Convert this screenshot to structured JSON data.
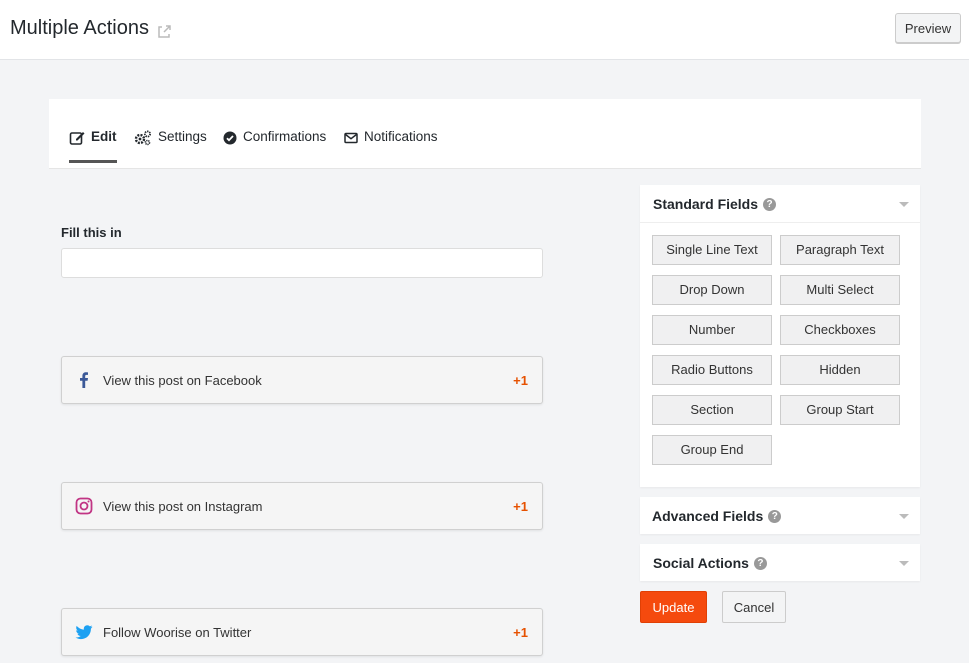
{
  "header": {
    "title": "Multiple Actions",
    "preview_label": "Preview"
  },
  "tabs": [
    {
      "label": "Edit",
      "icon": "edit-icon",
      "active": true
    },
    {
      "label": "Settings",
      "icon": "gears-icon",
      "active": false
    },
    {
      "label": "Confirmations",
      "icon": "check-circle-icon",
      "active": false
    },
    {
      "label": "Notifications",
      "icon": "envelope-icon",
      "active": false
    }
  ],
  "form": {
    "field_label": "Fill this in",
    "input_value": "",
    "actions": [
      {
        "label": "View this post on Facebook",
        "icon": "facebook-icon",
        "points": "+1"
      },
      {
        "label": "View this post on Instagram",
        "icon": "instagram-icon",
        "points": "+1"
      },
      {
        "label": "Follow Woorise on Twitter",
        "icon": "twitter-icon",
        "points": "+1"
      }
    ]
  },
  "sidebar": {
    "standard_fields": {
      "title": "Standard Fields",
      "buttons": [
        "Single Line Text",
        "Paragraph Text",
        "Drop Down",
        "Multi Select",
        "Number",
        "Checkboxes",
        "Radio Buttons",
        "Hidden",
        "Section",
        "Group Start",
        "Group End"
      ]
    },
    "advanced_fields": {
      "title": "Advanced Fields"
    },
    "social_actions": {
      "title": "Social Actions"
    },
    "help_glyph": "?"
  },
  "footer": {
    "update_label": "Update",
    "cancel_label": "Cancel"
  },
  "colors": {
    "accent": "#f54a0e",
    "points": "#e65100",
    "facebook": "#3b5998",
    "instagram": "#c13584",
    "twitter": "#1da1f2"
  }
}
